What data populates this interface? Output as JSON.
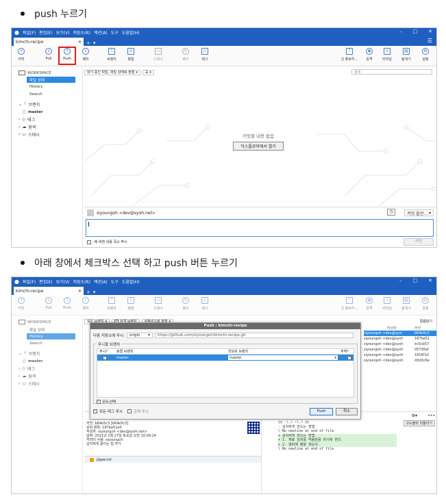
{
  "step1": {
    "text": "push 누르기"
  },
  "step2": {
    "text": "아래 창에서 체크박스 선택 하고 push 버튼 누르기"
  },
  "app": {
    "menu": [
      "파일(F)",
      "편집(E)",
      "보기(V)",
      "저장소(R)",
      "액션(A)",
      "도구",
      "도움말(H)"
    ],
    "tab": "kimchi-recipe",
    "window_controls": [
      "–",
      "□",
      "✕"
    ]
  },
  "toolbar": {
    "left": [
      {
        "label": "커밋",
        "icon": "commit-icon"
      },
      {
        "label": "Pull",
        "icon": "pull-icon"
      },
      {
        "label": "Push",
        "icon": "push-icon"
      },
      {
        "label": "패치",
        "icon": "fetch-icon"
      },
      {
        "label": "브랜치",
        "icon": "branch-icon"
      },
      {
        "label": "병합",
        "icon": "merge-icon"
      },
      {
        "label": "스태시",
        "icon": "stash-icon"
      },
      {
        "label": "폐기",
        "icon": "discard-icon"
      },
      {
        "label": "태그",
        "icon": "tag-icon"
      }
    ],
    "right": [
      {
        "label": "깃 플로우...",
        "icon": "gitflow-icon"
      },
      {
        "label": "원격",
        "icon": "remote-icon"
      },
      {
        "label": "터미널",
        "icon": "terminal-icon"
      },
      {
        "label": "탐색기",
        "icon": "explorer-icon"
      },
      {
        "label": "설정",
        "icon": "settings-icon"
      }
    ]
  },
  "sidebar": {
    "workspace": "WORKSPACE",
    "items": [
      "파일 상태",
      "History",
      "Search"
    ],
    "branches": "브랜치",
    "branch_master": "master",
    "tags": "태그",
    "remotes": "원격",
    "stashes": "스태시"
  },
  "status_view": {
    "filter_label": "대기 중인 파일, 파일 상태로 정렬",
    "filter_menu": "☰",
    "search_placeholder": "검색",
    "empty_text": "커밋할 내용 없음",
    "open_explorer": "익스플로러에서 열기",
    "author": "siyoungoh <dev@syoh.net>",
    "commit_options": "커밋 옵션...",
    "push_now": "-에 바뀐 내용 즉시 푸시",
    "commit_button": "커밋"
  },
  "screen2": {
    "filter_label": "모든 브랜치",
    "filter_remote": "원격 브랜치",
    "filter_order": "날짜순으로 정렬",
    "col_right": "컬럼워기",
    "log_header": [
      "작성자",
      "커밋"
    ],
    "log_rows": [
      {
        "author": "siyoungoh <dev@syoi",
        "hash": "b64e5c3"
      },
      {
        "author": "siyoungoh <dev@syoh",
        "hash": "187be51"
      },
      {
        "author": "siyoungoh <dev@syoh",
        "hash": "ec5cb57"
      },
      {
        "author": "siyoungoh <dev@syoh",
        "hash": "05736af"
      },
      {
        "author": "siyoungoh <dev@syoh",
        "hash": "1816f1d"
      },
      {
        "author": "siyoungoh <dev@syoh",
        "hash": "d3d3c6e"
      }
    ],
    "commit_detail": [
      "커밋: b64e5c3 [b64e5c3]",
      "상위 항목: 187be51e0",
      "작성자: siyoungoh <dev@syoh.net>",
      "날짜: 2021년 2월 27일 토요일 오전 10:09:24",
      "커미터 사람: siyoungoh",
      "",
      "김치찌개 끓이는 법 추가"
    ],
    "file_name": "jjigae.txt",
    "diff_lines": [
      {
        "text": "@@ -1,2 +1,3 @@",
        "type": "meta"
      },
      {
        "text": "- 김치찌개 만드는 방법",
        "type": "ctx"
      },
      {
        "text": "\\ No newline at end of file",
        "type": "ctx"
      },
      {
        "text": "+ 김치찌개 만드는 방법",
        "type": "add"
      },
      {
        "text": "+ 1. 재료 김치를 먹음만큼 자기에 썬다.",
        "type": "add"
      },
      {
        "text": "+ 2. 냄비에 물을 붓는다.",
        "type": "add"
      },
      {
        "text": "\\ No newline at end of file",
        "type": "ctx"
      }
    ],
    "diff_button": "코드블럭 되돌리기"
  },
  "dialog": {
    "title": "Push : kimchi-recipe",
    "remote_label": "다음 저장소에 푸시:",
    "remote_value": "origin",
    "remote_url": "https://github.com/siyoungoh/kimchi-recipe.git",
    "branches_group": "푸시할 브랜치",
    "headers": [
      "푸시?",
      "로컬 브랜치",
      "리모트 브랜치",
      "추적?"
    ],
    "row": {
      "local": "master",
      "remote": "master"
    },
    "select_all": "모두선택",
    "push_all_tags": "모든 태그 푸시",
    "force_push": "강제 푸시",
    "push_button": "Push",
    "cancel_button": "취소"
  }
}
